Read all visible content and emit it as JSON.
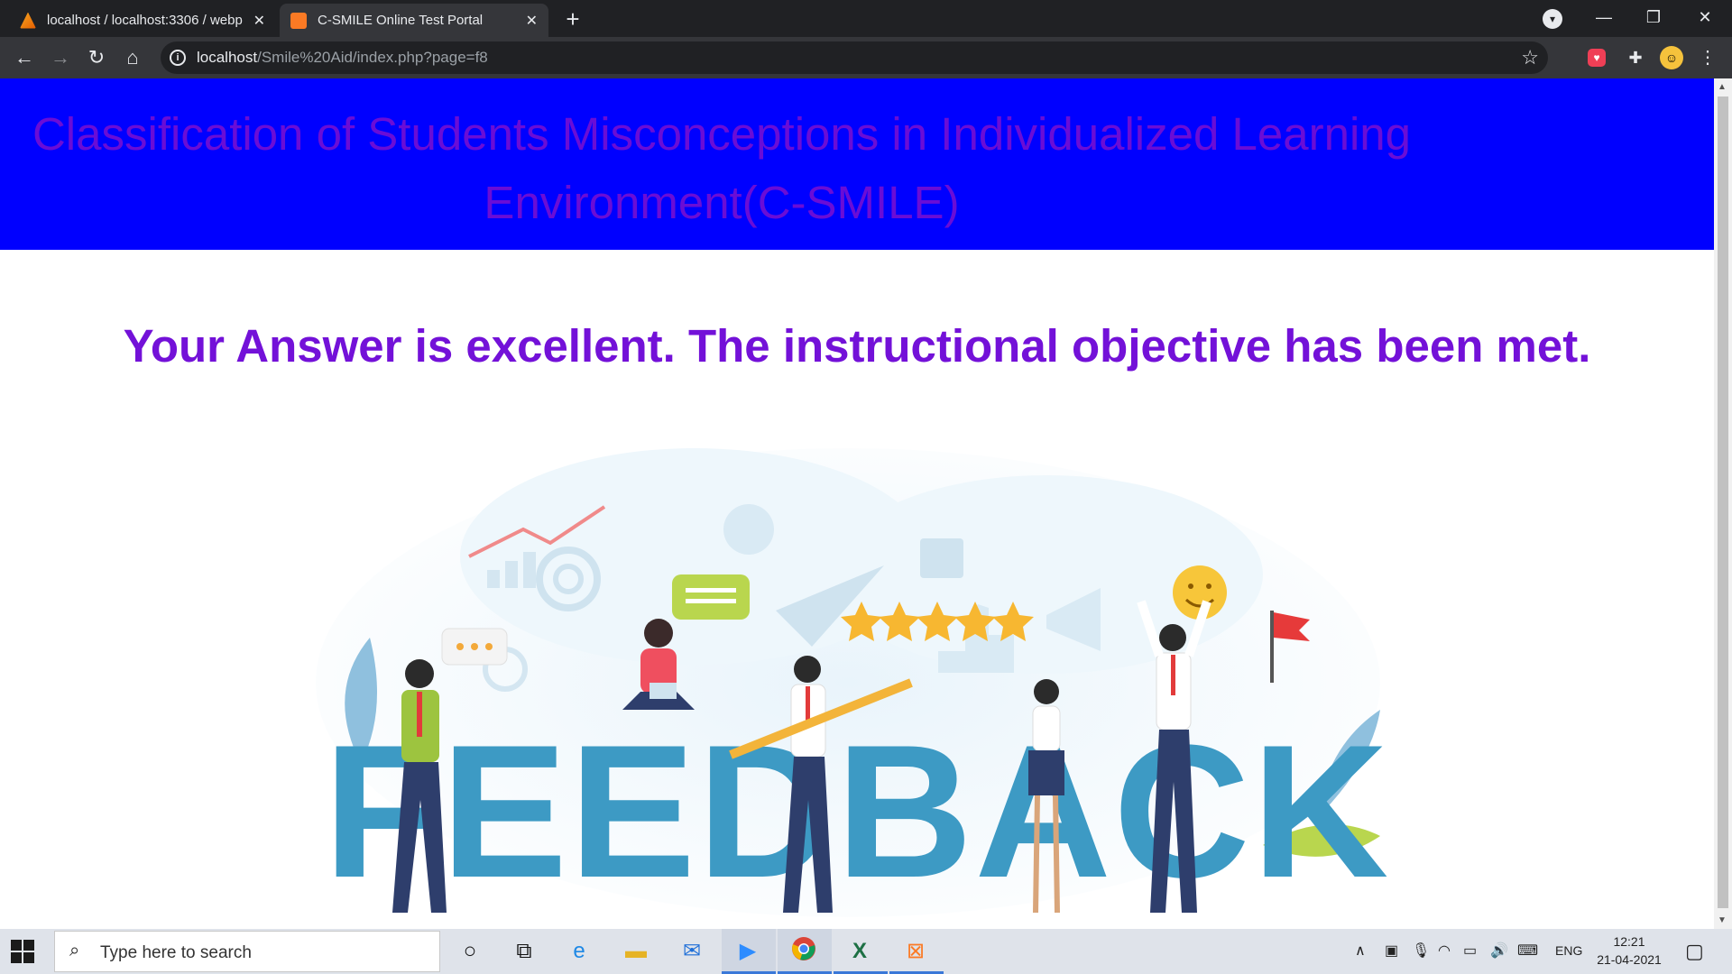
{
  "browser": {
    "tabs": [
      {
        "title": "localhost / localhost:3306 / webp",
        "active": false
      },
      {
        "title": "C-SMILE Online Test Portal",
        "active": true
      }
    ],
    "new_tab_symbol": "+",
    "url_host": "localhost",
    "url_path": "/Smile%20Aid/index.php?page=f8",
    "icons": {
      "back": "arrow-left-icon",
      "forward": "arrow-right-icon",
      "reload": "reload-icon",
      "home": "home-icon",
      "info": "info-icon",
      "bookmark": "star-icon",
      "pocket": "pocket-extension-icon",
      "extensions": "puzzle-icon",
      "menu": "kebab-menu-icon"
    }
  },
  "page": {
    "banner_title": "Classification of Students Misconceptions in Individualized Learning Environment(C-SMILE)",
    "message": "Your Answer is excellent. The instructional objective has been met.",
    "illustration_word": "FEEDBACK",
    "rating_stars": 5,
    "colors": {
      "banner_bg": "#0000ff",
      "banner_text": "#6a0dd6",
      "message_text": "#7311d8",
      "feedback_letters": "#3d9ac4"
    }
  },
  "taskbar": {
    "search_placeholder": "Type here to search",
    "language": "ENG",
    "time": "12:21",
    "date": "21-04-2021",
    "apps": [
      "cortana",
      "task-view",
      "edge",
      "file-explorer",
      "mail",
      "zoom",
      "chrome",
      "excel",
      "xampp"
    ]
  }
}
